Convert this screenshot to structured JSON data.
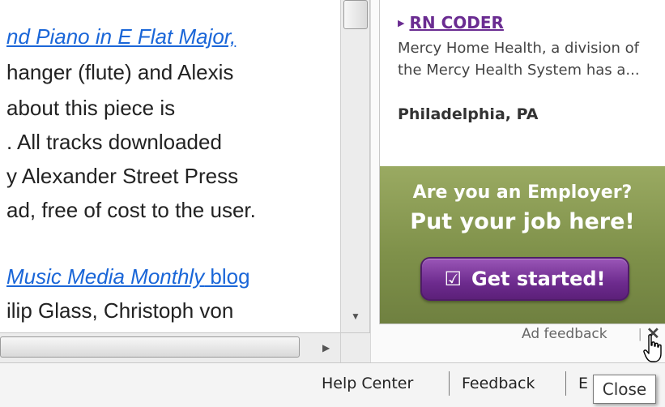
{
  "article": {
    "top_partial": "y",
    "lines": [
      {
        "link_text": "nd Piano in E Flat Major,"
      },
      {
        "text": "hanger (flute) and Alexis"
      },
      {
        "text": "about this piece is"
      },
      {
        "text": ". All tracks downloaded"
      },
      {
        "text": "y Alexander Street Press"
      },
      {
        "text": "ad, free of cost to the user."
      },
      {
        "link_text": "Music Media Monthly",
        "link_suffix": " blog"
      },
      {
        "text": "ilip Glass, Christoph von"
      }
    ]
  },
  "ad": {
    "job_title": "RN CODER",
    "job_description": "Mercy Home Health, a division of the Mercy Health System has a...",
    "job_location": "Philadelphia, PA",
    "employer_question": "Are you an Employer?",
    "employer_cta": "Put your job here!",
    "get_started_label": "Get started!",
    "feedback_label": "Ad feedback",
    "close_glyph": "✕",
    "colors": {
      "job_link": "#6a2c91",
      "button": "#6d2b8e",
      "panel": "#7f914a"
    }
  },
  "footer": {
    "links": [
      "Help Center",
      "Feedback",
      "E"
    ]
  },
  "tooltip": {
    "label": "Close"
  }
}
